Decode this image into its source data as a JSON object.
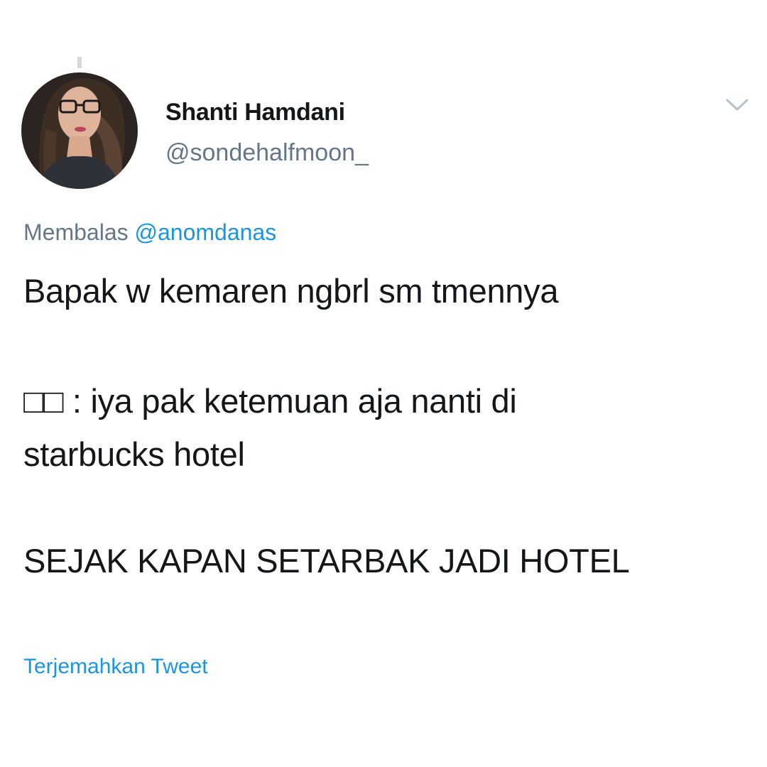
{
  "user": {
    "display_name": "Shanti Hamdani",
    "handle": "@sondehalfmoon_"
  },
  "reply": {
    "prefix": "Membalas",
    "target": "@anomdanas"
  },
  "tweet": {
    "lines": [
      "Bapak w kemaren ngbrl sm tmennya",
      "□□ : iya pak ketemuan aja nanti di",
      "starbucks hotel",
      "SEJAK KAPAN SETARBAK JADI HOTEL"
    ]
  },
  "actions": {
    "translate_label": "Terjemahkan Tweet"
  },
  "icons": {
    "menu": "chevron-down-icon"
  },
  "colors": {
    "text": "#14171a",
    "secondary": "#657786",
    "link": "#1b95e0"
  }
}
